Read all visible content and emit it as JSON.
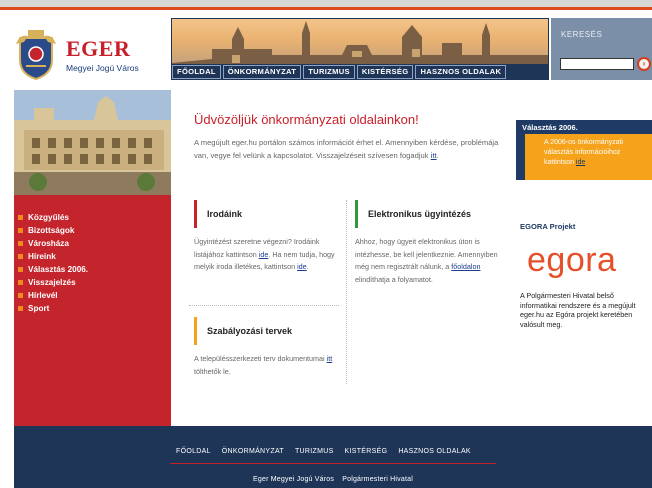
{
  "logo": {
    "title": "EGER",
    "subtitle": "Megyei Jogú Város"
  },
  "nav": [
    "FŐOLDAL",
    "ÖNKORMÁNYZAT",
    "TURIZMUS",
    "KISTÉRSÉG",
    "HASZNOS OLDALAK"
  ],
  "search": {
    "label": "KERESÉS",
    "value": ""
  },
  "sidebar": {
    "items": [
      "Közgyűlés",
      "Bizottságok",
      "Városháza",
      "Híreink",
      "Választás 2006.",
      "Visszajelzés",
      "Hírlevél",
      "Sport"
    ]
  },
  "main": {
    "welcome": "Üdvözöljük önkormányzati oldalainkon!",
    "intro": {
      "text": "A megújult eger.hu portálon számos információt érhet el. Amennyiben kérdése, problémája van, vegye fel velünk a kapcsolatot. Visszajelzéseit szívesen fogadjuk ",
      "link": "itt"
    },
    "boxes": {
      "offices": {
        "title": "Irodáink",
        "text1": "Ügyintézést szeretne végezni? Irodáink listájához kattintson ",
        "link1": "ide",
        "text2": ". Ha nem tudja, hogy melyik iroda illetékes, kattintson ",
        "link2": "ide",
        "end": "."
      },
      "electronic": {
        "title": "Elektronikus ügyintézés",
        "text1": "Ahhoz, hogy ügyeit elektronikus úton is intézhesse, be kell jelentkeznie. Amennyiben még nem regisztrált nálunk, a ",
        "link1": "főoldalon",
        "text2": " elindíthatja a folyamatot."
      },
      "plans": {
        "title": "Szabályozási tervek",
        "text1": "A településszerkezeti terv dokumentumai ",
        "link1": "itt",
        "text2": " tölthetők le."
      }
    }
  },
  "right": {
    "election_title": "Választás 2006.",
    "election_text": "A 2006-os önkormányzati választás információihoz kattintson ",
    "election_link": "ide",
    "egora_title": "EGORA Projekt",
    "egora_logo": "egora",
    "egora_text": "A Polgármesteri Hivatal belső informatikai rendszere és a megújult eger.hu az Egóra projekt keretében valósult meg."
  },
  "footer": {
    "nav": [
      "FŐOLDAL",
      "ÖNKORMÁNYZAT",
      "TURIZMUS",
      "KISTÉRSÉG",
      "HASZNOS OLDALAK"
    ],
    "bottom": [
      "Eger Megyei Jogú Város",
      "Polgármesteri Hivatal"
    ]
  },
  "colors": {
    "brand_red": "#c4242b",
    "navy": "#1e3558",
    "orange": "#f6a21a",
    "green": "#2e9a3d"
  }
}
